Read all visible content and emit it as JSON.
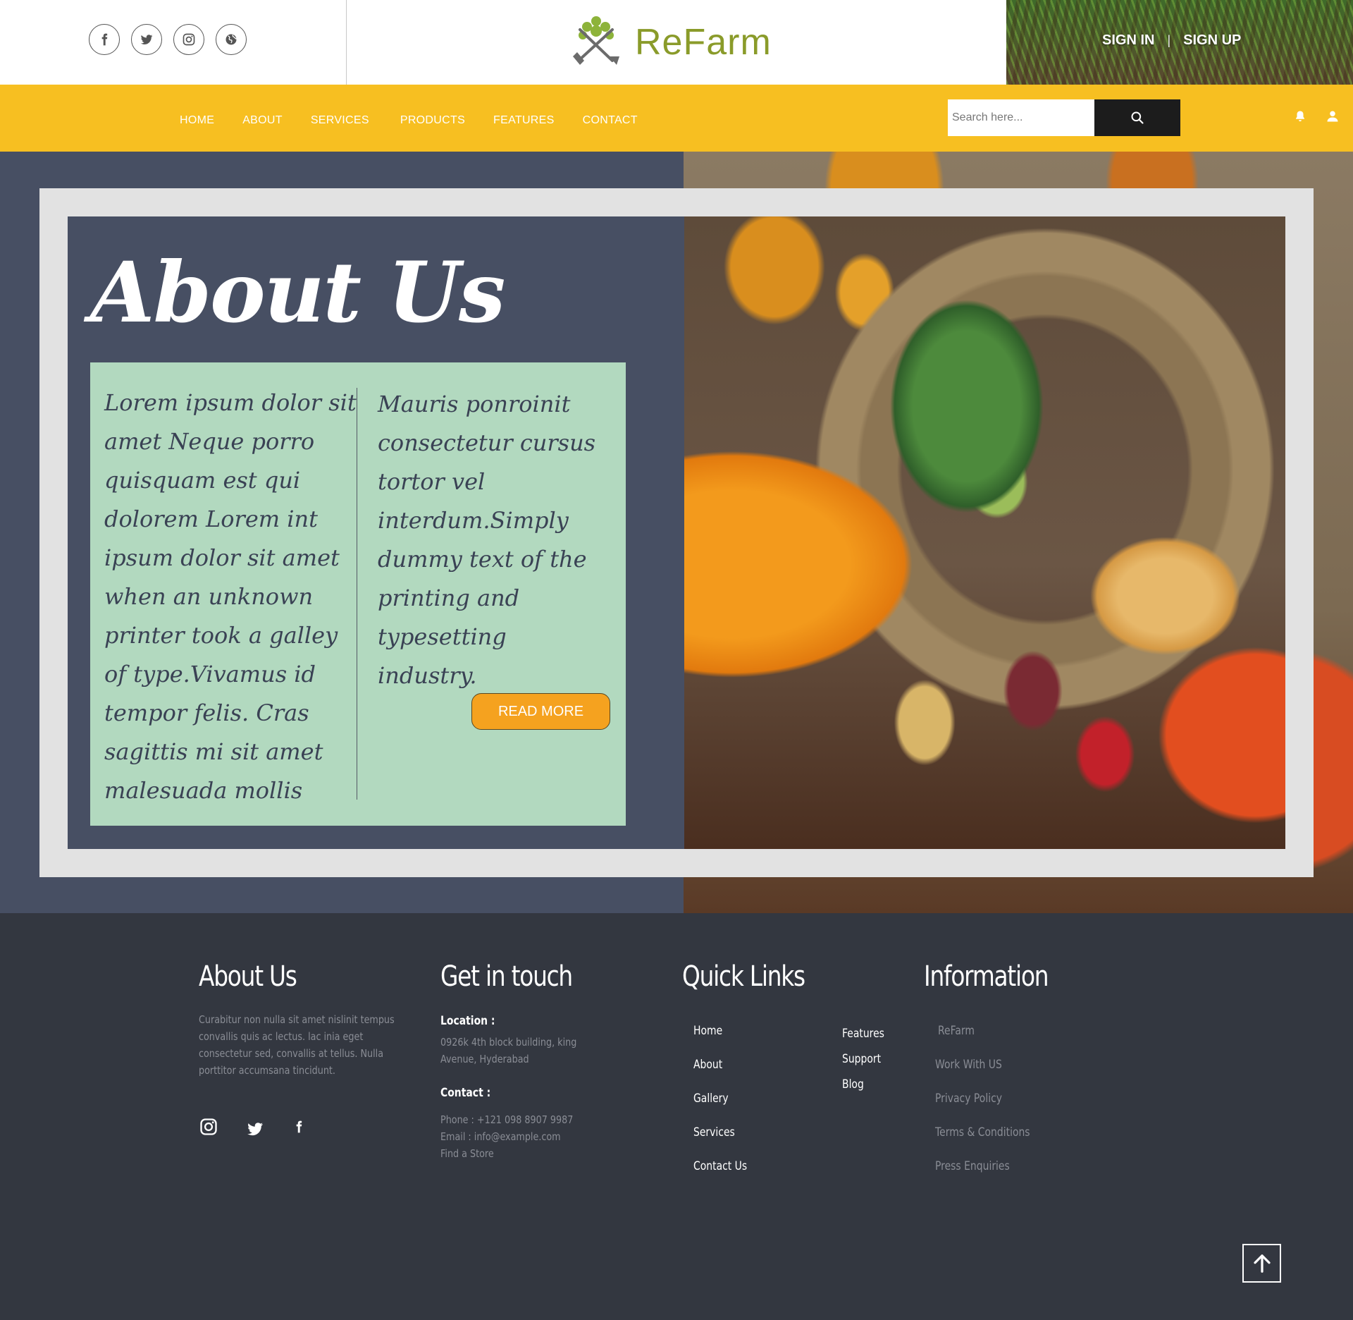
{
  "header": {
    "brand": "ReFarm",
    "social_icons": [
      "facebook-icon",
      "twitter-icon",
      "instagram-icon",
      "globe-icon"
    ],
    "sign_in": "SIGN IN",
    "separator": "|",
    "sign_up": "SIGN UP"
  },
  "nav": {
    "items": [
      "HOME",
      "ABOUT",
      "SERVICES",
      "PRODUCTS",
      "FEATURES",
      "CONTACT"
    ],
    "search_placeholder": "Search here...",
    "icons": [
      "bell-icon",
      "user-icon"
    ]
  },
  "about": {
    "title": "About Us",
    "col1": "Lorem ipsum dolor sit amet Neque porro quisquam est qui dolorem Lorem int ipsum dolor sit amet when an unknown printer took a galley of type.Vivamus id tempor felis. Cras sagittis mi sit amet malesuada mollis",
    "col2": "Mauris ponroinit consectetur cursus tortor vel interdum.Simply dummy text of the printing and typesetting industry.",
    "read_more": "READ MORE"
  },
  "footer": {
    "about": {
      "heading": "About Us",
      "text": "Curabitur non nulla sit amet nislinit tempus convallis quis ac lectus. lac inia eget consectetur sed, convallis at tellus. Nulla porttitor accumsana tincidunt.",
      "social_icons": [
        "instagram-icon",
        "twitter-icon",
        "facebook-icon"
      ]
    },
    "contact": {
      "heading": "Get in touch",
      "location_label": "Location :",
      "location_text": "0926k 4th block building, king Avenue, Hyderabad",
      "contact_label": "Contact :",
      "phone": "Phone : +121 098 8907 9987",
      "email": "Email : info@example.com",
      "store": "Find a Store"
    },
    "quick_links": {
      "heading": "Quick Links",
      "col1": [
        "Home",
        "About",
        "Gallery",
        "Services",
        "Contact Us"
      ],
      "col2": [
        "Features",
        "Support",
        "Blog"
      ]
    },
    "information": {
      "heading": "Information",
      "items": [
        "ReFarm",
        "Work With US",
        "Privacy Policy",
        "Terms & Conditions",
        "Press Enquiries"
      ]
    }
  },
  "colors": {
    "nav_bar": "#f7bf21",
    "hero_panel": "#474f63",
    "about_box": "#b2d9bf",
    "button": "#f5a21f",
    "footer": "#333740",
    "brand_green": "#8a9b2a"
  }
}
